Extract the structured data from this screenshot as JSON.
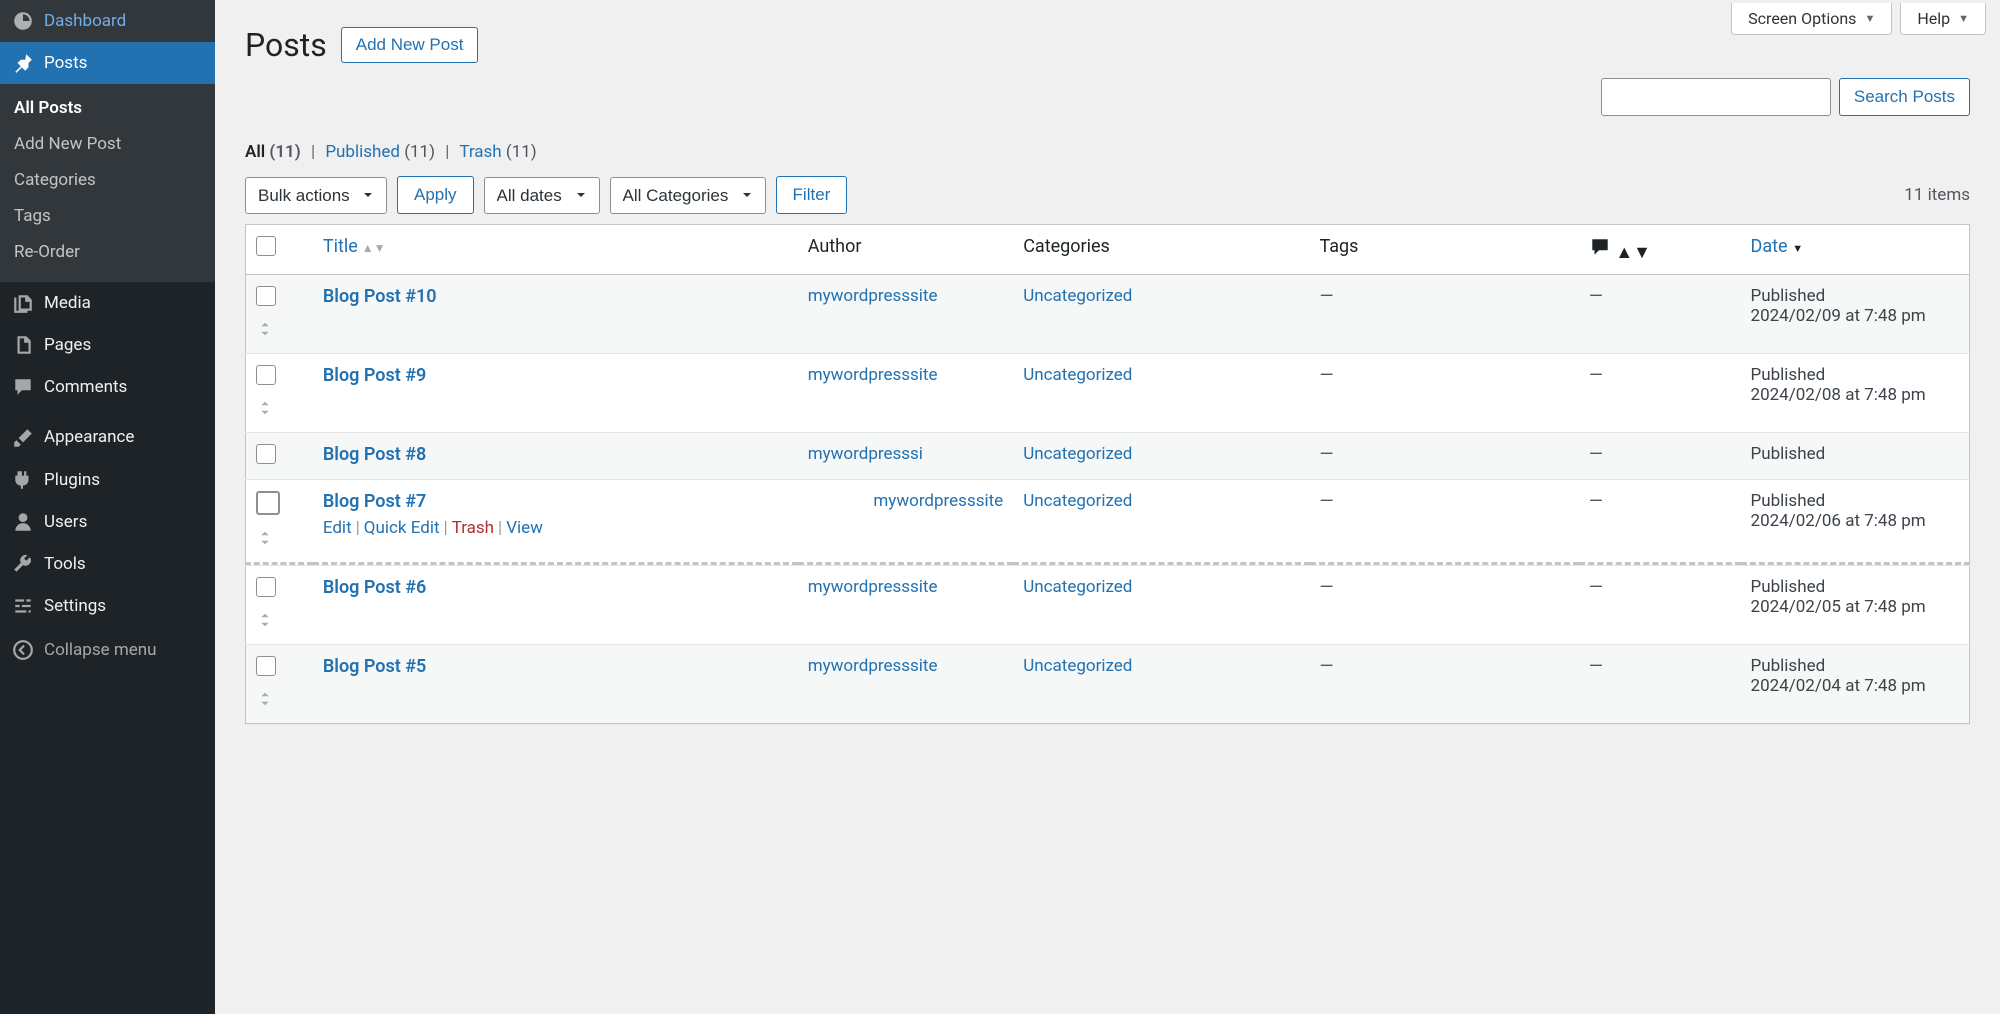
{
  "sidebar": {
    "dashboard": "Dashboard",
    "posts": "Posts",
    "posts_sub": {
      "all": "All Posts",
      "add": "Add New Post",
      "categories": "Categories",
      "tags": "Tags",
      "reorder": "Re-Order"
    },
    "media": "Media",
    "pages": "Pages",
    "comments": "Comments",
    "appearance": "Appearance",
    "plugins": "Plugins",
    "users": "Users",
    "tools": "Tools",
    "settings": "Settings",
    "collapse": "Collapse menu"
  },
  "top": {
    "screen_options": "Screen Options",
    "help": "Help"
  },
  "heading": "Posts",
  "add_new_label": "Add New Post",
  "subsub": {
    "all": "All",
    "all_count": "(11)",
    "published": "Published",
    "published_count": "(11)",
    "trash": "Trash",
    "trash_count": "(11)"
  },
  "filters": {
    "bulk": "Bulk actions",
    "apply": "Apply",
    "dates": "All dates",
    "categories": "All Categories",
    "filter": "Filter"
  },
  "items_count": "11 items",
  "search": {
    "button": "Search Posts",
    "placeholder": ""
  },
  "columns": {
    "title": "Title",
    "author": "Author",
    "categories": "Categories",
    "tags": "Tags",
    "date": "Date"
  },
  "row_actions": {
    "edit": "Edit",
    "quick_edit": "Quick Edit",
    "trash": "Trash",
    "view": "View"
  },
  "rows": [
    {
      "title": "Blog Post #10",
      "author": "mywordpresssite",
      "category": "Uncategorized",
      "tags": "—",
      "comments": "—",
      "status": "Published",
      "date": "2024/02/09 at 7:48 pm",
      "alt": true,
      "author_col": "narrow",
      "actions": false
    },
    {
      "title": "Blog Post #9",
      "author": "mywordpresssite",
      "category": "Uncategorized",
      "tags": "—",
      "comments": "—",
      "status": "Published",
      "date": "2024/02/08 at 7:48 pm",
      "alt": false,
      "author_col": "narrow",
      "actions": false
    },
    {
      "title": "Blog Post #8",
      "author": "mywordpresssi",
      "category": "Uncategorized",
      "tags": "—",
      "comments": "—",
      "status": "Published",
      "date": "",
      "alt": true,
      "author_col": "narrow",
      "actions": false,
      "collapsed": true
    },
    {
      "title": "Blog Post #7",
      "author": "mywordpresssite",
      "category": "Uncategorized",
      "tags": "—",
      "comments": "—",
      "status": "Published",
      "date": "2024/02/06 at 7:48 pm",
      "alt": false,
      "author_col": "wide",
      "actions": true,
      "big_cb": true
    },
    {
      "drop": true
    },
    {
      "title": "Blog Post #6",
      "author": "mywordpresssite",
      "category": "Uncategorized",
      "tags": "—",
      "comments": "—",
      "status": "Published",
      "date": "2024/02/05 at 7:48 pm",
      "alt": false,
      "author_col": "narrow",
      "actions": false
    },
    {
      "title": "Blog Post #5",
      "author": "mywordpresssite",
      "category": "Uncategorized",
      "tags": "—",
      "comments": "—",
      "status": "Published",
      "date": "2024/02/04 at 7:48 pm",
      "alt": true,
      "author_col": "narrow",
      "actions": false
    }
  ]
}
